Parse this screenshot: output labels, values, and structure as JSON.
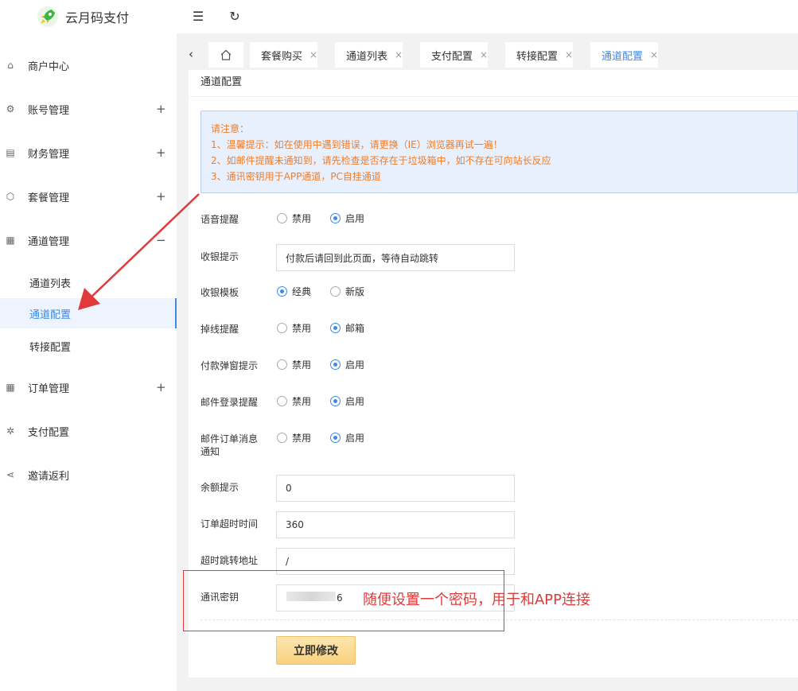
{
  "app": {
    "title": "云月码支付"
  },
  "sidebar": {
    "items": [
      {
        "label": "商户中心",
        "icon": "home-icon",
        "expand": ""
      },
      {
        "label": "账号管理",
        "icon": "gear-icon",
        "expand": "+"
      },
      {
        "label": "财务管理",
        "icon": "book-icon",
        "expand": "+"
      },
      {
        "label": "套餐管理",
        "icon": "box-icon",
        "expand": "+"
      },
      {
        "label": "通道管理",
        "icon": "grid-icon",
        "expand": "−"
      },
      {
        "label": "订单管理",
        "icon": "grid-icon",
        "expand": "+"
      },
      {
        "label": "支付配置",
        "icon": "settings-icon",
        "expand": ""
      },
      {
        "label": "邀请返利",
        "icon": "share-icon",
        "expand": ""
      }
    ],
    "subitems": [
      {
        "label": "通道列表"
      },
      {
        "label": "通道配置",
        "active": true
      },
      {
        "label": "转接配置"
      }
    ]
  },
  "tabs": [
    {
      "label": "套餐购买",
      "close": "×"
    },
    {
      "label": "通道列表",
      "close": "×"
    },
    {
      "label": "支付配置",
      "close": "×"
    },
    {
      "label": "转接配置",
      "close": "×"
    },
    {
      "label": "通道配置",
      "close": "×",
      "active": true
    }
  ],
  "card": {
    "title": "通道配置",
    "notice": [
      "请注意：",
      "1、温馨提示：如在使用中遇到错误，请更换（IE）浏览器再试一遍！",
      "2、如邮件提醒未通知到，请先检查是否存在于垃圾箱中，如不存在可向站长反应",
      "3、通讯密钥用于APP通道，PC自挂通道"
    ]
  },
  "form": {
    "voice": {
      "label": "语音提醒",
      "opt1": "禁用",
      "opt2": "启用",
      "selected": 2
    },
    "cashier_tip": {
      "label": "收银提示",
      "value": "付款后请回到此页面，等待自动跳转"
    },
    "cashier_template": {
      "label": "收银模板",
      "opt1": "经典",
      "opt2": "新版",
      "selected": 1
    },
    "offline": {
      "label": "掉线提醒",
      "opt1": "禁用",
      "opt2": "邮箱",
      "selected": 2
    },
    "payment_popup": {
      "label": "付款弹窗提示",
      "opt1": "禁用",
      "opt2": "启用",
      "selected": 2
    },
    "email_login": {
      "label": "邮件登录提醒",
      "opt1": "禁用",
      "opt2": "启用",
      "selected": 2
    },
    "email_order": {
      "label_line1": "邮件订单消息",
      "label_line2": "通知",
      "opt1": "禁用",
      "opt2": "启用",
      "selected": 2
    },
    "balance": {
      "label": "余额提示",
      "value": "0"
    },
    "order_timeout": {
      "label": "订单超时时间",
      "value": "360"
    },
    "timeout_url": {
      "label": "超时跳转地址",
      "value": "/"
    },
    "secret": {
      "label": "通讯密钥",
      "value": "6"
    },
    "submit_label": "立即修改"
  },
  "annotation": {
    "text": "随便设置一个密码，用于和APP连接",
    "color": "#e03a3a"
  },
  "colors": {
    "accent": "#3b8ae6",
    "notice_text": "#f07d2a",
    "annotation": "#e03a3a"
  }
}
